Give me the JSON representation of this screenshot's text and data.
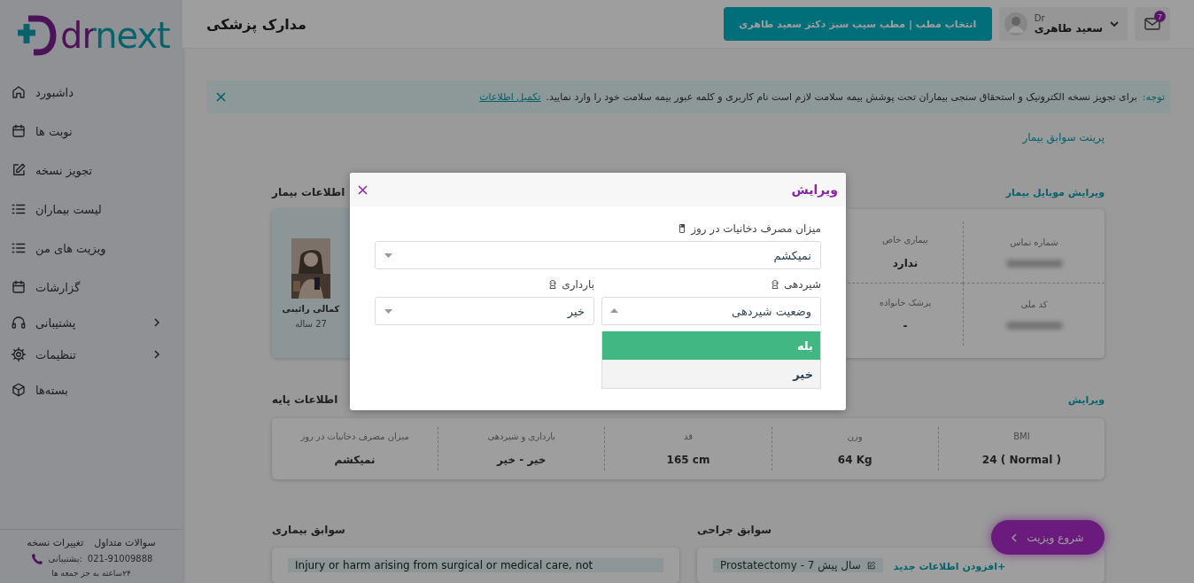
{
  "sidebar": {
    "logo": "drnext",
    "items": [
      {
        "label": "داشبورد",
        "submenu": false
      },
      {
        "label": "نوبت ها",
        "submenu": false
      },
      {
        "label": "تجویز نسخه",
        "submenu": false
      },
      {
        "label": "لیست بیماران",
        "submenu": false
      },
      {
        "label": "ویزیت های من",
        "submenu": false
      },
      {
        "label": "گزارشات",
        "submenu": false
      },
      {
        "label": "پشتیبانی",
        "submenu": true
      },
      {
        "label": "تنظیمات",
        "submenu": true
      },
      {
        "label": "بسته‌ها",
        "submenu": false
      }
    ],
    "footer": {
      "links": [
        "سوالات متداول",
        "تغییرات نسخه"
      ],
      "phone": "021-91009888",
      "phone_label": ":پشتیبانی",
      "hours": "۲۴ساعته به جز جمعه ها"
    }
  },
  "header": {
    "title": "مدارک پزشکی",
    "clinic_button": "انتخاب مطب | مطب سیب سبز دکتر سعید طاهری",
    "user": {
      "prefix": "Dr",
      "name": "سعید طاهری"
    },
    "mail_badge": "7"
  },
  "notice": {
    "label": "توجه:",
    "text": "برای تجویز نسخه الکترونیک و استحقاق سنجی بیماران تحت پوشش بیمه سلامت لازم است نام کاربری و کلمه عبور بیمه سلامت خود را وارد نمایید.",
    "link": "تکمیل اطلاعات"
  },
  "print_link": "پرینت سوابق بیمار",
  "patient_info": {
    "title": "اطلاعات بیمار",
    "edit_link": "ویرایش موبایل بیمار",
    "name": "کمالی رائینی",
    "age": "27 ساله",
    "fields": [
      {
        "label": "شماره تماس",
        "blurred": true
      },
      {
        "label": "بیماری خاص",
        "value": "ندارد",
        "blurred": false
      },
      {
        "label": "کد ملی",
        "blurred": true
      },
      {
        "label": "پزشک خانواده",
        "value": "-",
        "blurred": false
      }
    ]
  },
  "basic_info": {
    "title": "اطلاعات پایه",
    "edit_link": "ویرایش",
    "fields": [
      {
        "label": "BMI",
        "value": "24 ( Normal )"
      },
      {
        "label": "وزن",
        "value": "64 Kg"
      },
      {
        "label": "قد",
        "value": "165 cm"
      },
      {
        "label": "بارداری و شیردهی",
        "value": "خیر - خیر"
      },
      {
        "label": "میزان مصرف دخانیات در روز",
        "value": "نمیکشم"
      }
    ]
  },
  "surgery_history": {
    "title": "سوابق جراحی",
    "add_link": "+افزودن اطلاعات جدید",
    "chips": [
      "Prostatectomy - 7 سال پیش"
    ]
  },
  "disease_history": {
    "title": "سوابق بیماری",
    "entries": [
      "Injury or harm arising from surgical or medical care, not"
    ]
  },
  "start_visit_button": "شروع ویزیت",
  "edit_dialog": {
    "title": "ویرایش",
    "rows": [
      [
        {
          "label": "میزان مصرف دخانیات در روز",
          "value": "نمیکشم",
          "open": false
        }
      ],
      [
        {
          "label": "شیردهی",
          "placeholder": "وضعیت شیردهی",
          "open": true,
          "options": [
            {
              "label": "بله",
              "highlighted": true
            },
            {
              "label": "خیر",
              "highlighted": false
            }
          ]
        },
        {
          "label": "بارداری",
          "value": "خیر",
          "open": false
        }
      ]
    ]
  }
}
